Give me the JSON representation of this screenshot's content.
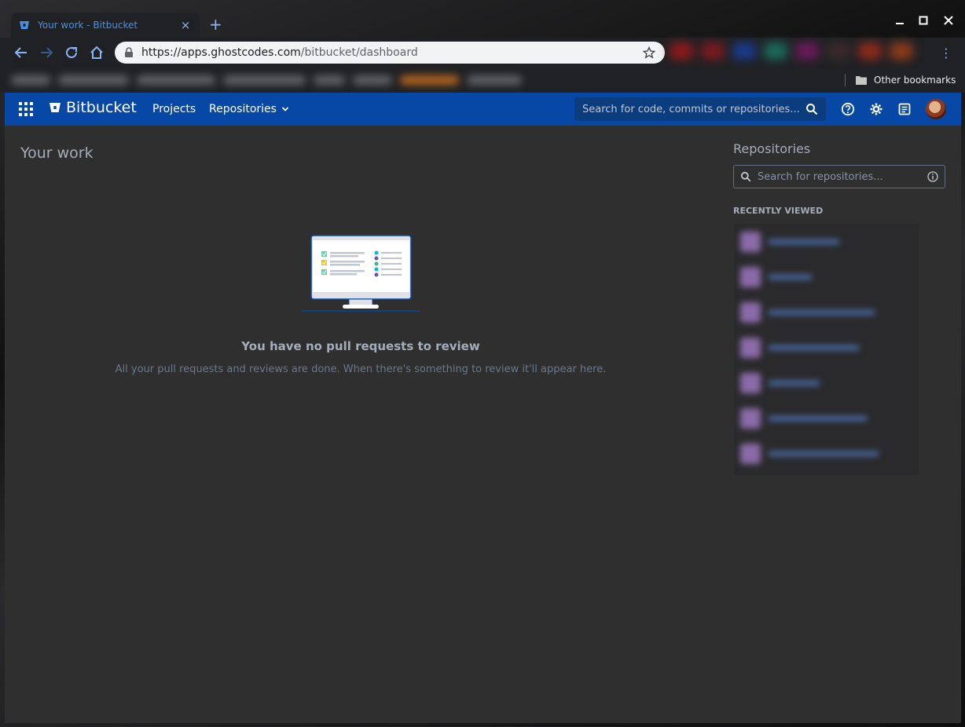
{
  "browser": {
    "tab_title": "Your work - Bitbucket",
    "tab_close": "×",
    "new_tab": "+",
    "url_host": "https://apps.ghostcodes.com",
    "url_path": "/bitbucket/dashboard",
    "other_bookmarks": "Other bookmarks"
  },
  "header": {
    "product": "Bitbucket",
    "nav": [
      "Projects",
      "Repositories"
    ],
    "search_placeholder": "Search for code, commits or repositories..."
  },
  "main": {
    "title": "Your work",
    "empty_title": "You have no pull requests to review",
    "empty_description": "All your pull requests and reviews are done. When there's something to review it'll appear here."
  },
  "sidebar": {
    "title": "Repositories",
    "search_placeholder": "Search for repositories...",
    "recently_viewed_label": "RECENTLY VIEWED",
    "recent_count": 7
  },
  "colors": {
    "header_bg": "#0747a6",
    "page_bg": "#2f2f2f",
    "browser_chrome": "#202124"
  }
}
